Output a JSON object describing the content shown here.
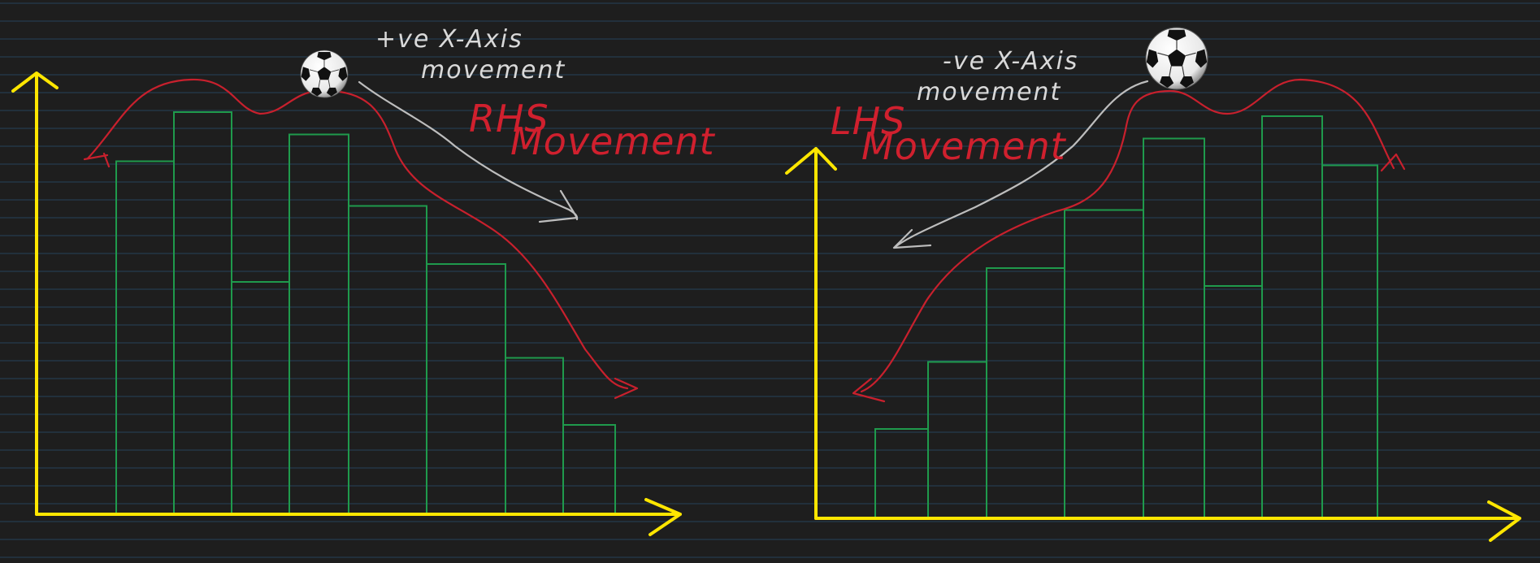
{
  "colors": {
    "background": "#1e1e1e",
    "ruled_lines": "#26425a",
    "axis": "#ffe600",
    "bar_outline": "#1f9a4c",
    "curve": "#c8202d",
    "annotation_text": "#d9d9d9",
    "movement_label": "#d0202e",
    "pointer_arrow": "#bdbdbd"
  },
  "left_panel": {
    "annotation_line1": "+ve  X-Axis",
    "annotation_line2": "movement",
    "movement_label_line1": "RHS",
    "movement_label_line2": "Movement",
    "ball_icon": "soccer-ball-icon",
    "bar_heights": [
      0.79,
      0.9,
      0.52,
      0.85,
      0.69,
      0.56,
      0.35,
      0.2
    ]
  },
  "right_panel": {
    "annotation_line1": "-ve  X-Axis",
    "annotation_line2": "movement",
    "movement_label_line1": "LHS",
    "movement_label_line2": "Movement",
    "ball_icon": "soccer-ball-icon",
    "bar_heights": [
      0.2,
      0.35,
      0.56,
      0.69,
      0.85,
      0.52,
      0.9,
      0.79
    ]
  }
}
